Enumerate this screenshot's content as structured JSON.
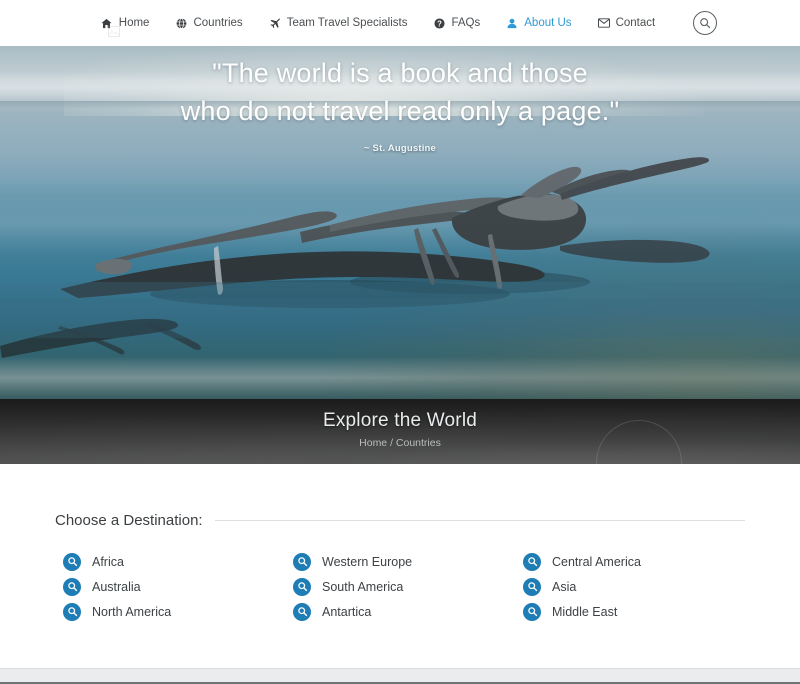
{
  "site": {
    "logo_alt": "logo"
  },
  "nav": {
    "items": [
      {
        "label": "Home",
        "icon": "home-icon",
        "active": false
      },
      {
        "label": "Countries",
        "icon": "globe-icon",
        "active": false
      },
      {
        "label": "Team Travel Specialists",
        "icon": "plane-icon",
        "active": false
      },
      {
        "label": "FAQs",
        "icon": "question-icon",
        "active": false
      },
      {
        "label": "About Us",
        "icon": "user-icon",
        "active": true
      },
      {
        "label": "Contact",
        "icon": "envelope-icon",
        "active": false
      }
    ],
    "search_icon": "search-icon",
    "active_color": "#2e9ad4"
  },
  "hero": {
    "quote_line1": "\"The world is a book and those",
    "quote_line2": "who do not travel read only a page.\"",
    "attribution": "~ St. Augustine",
    "image_alt": "driftwood-in-calm-blue-water"
  },
  "banner": {
    "title": "Explore the World",
    "breadcrumb": "Home / Countries",
    "breadcrumb_parts": [
      "Home",
      "/",
      "Countries"
    ]
  },
  "main": {
    "section_title": "Choose a Destination:",
    "destination_icon": "search-circle-icon",
    "destination_icon_color": "#1e7db5",
    "destinations": [
      {
        "label": "Africa"
      },
      {
        "label": "Western Europe"
      },
      {
        "label": "Central America"
      },
      {
        "label": "Australia"
      },
      {
        "label": "South America"
      },
      {
        "label": "Asia"
      },
      {
        "label": "North America"
      },
      {
        "label": "Antartica"
      },
      {
        "label": "Middle East"
      }
    ]
  }
}
